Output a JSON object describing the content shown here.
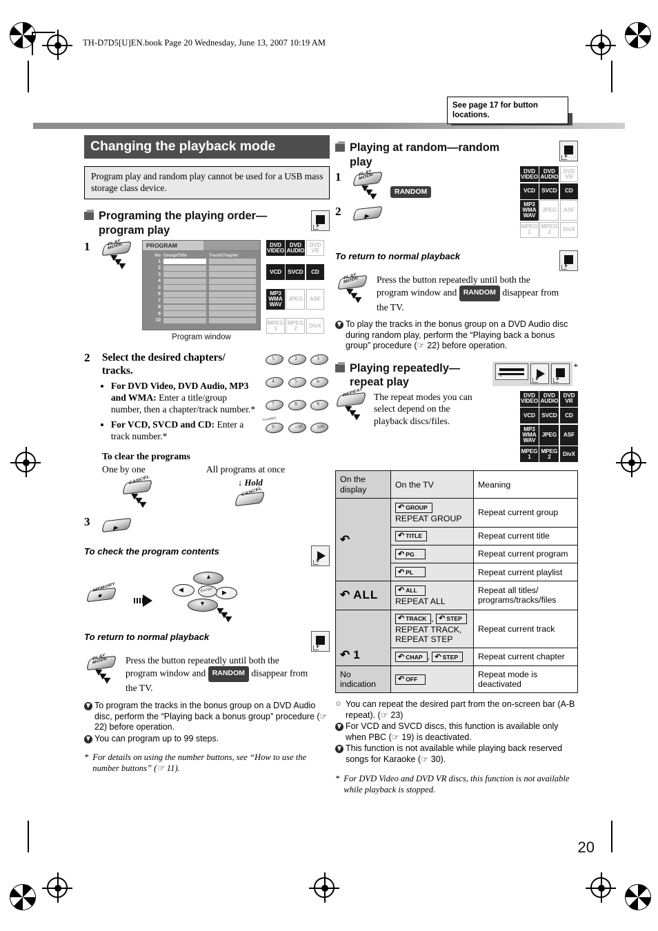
{
  "file_header": "TH-D7D5[U]EN.book  Page 20  Wednesday, June 13, 2007  10:19 AM",
  "page_number": "20",
  "callout": {
    "text": "See page 17 for button locations."
  },
  "left_column": {
    "section_title": "Changing the playback mode",
    "notice": "Program play and random play cannot be used for a USB mass storage class device.",
    "program": {
      "heading": "Programing the playing order—program play",
      "mode_icon": "stop-mode-icon",
      "discs": [
        {
          "label": "DVD VIDEO",
          "lines": [
            "DVD",
            "VIDEO"
          ],
          "active": true
        },
        {
          "label": "DVD AUDIO",
          "lines": [
            "DVD",
            "AUDIO"
          ],
          "active": true
        },
        {
          "label": "DVD VR",
          "lines": [
            "DVD",
            "VR"
          ],
          "active": false
        },
        {
          "label": "VCD",
          "lines": [
            "VCD"
          ],
          "active": true
        },
        {
          "label": "SVCD",
          "lines": [
            "SVCD"
          ],
          "active": true
        },
        {
          "label": "CD",
          "lines": [
            "CD"
          ],
          "active": true
        },
        {
          "label": "MP3 WMA WAV",
          "lines": [
            "MP3",
            "WMA",
            "WAV"
          ],
          "active": true
        },
        {
          "label": "JPEG",
          "lines": [
            "JPEG"
          ],
          "active": false
        },
        {
          "label": "ASF",
          "lines": [
            "ASF"
          ],
          "active": false
        },
        {
          "label": "MPEG 1",
          "lines": [
            "MPEG",
            "1"
          ],
          "active": false
        },
        {
          "label": "MPEG 2",
          "lines": [
            "MPEG",
            "2"
          ],
          "active": false
        },
        {
          "label": "DivX",
          "lines": [
            "DivX"
          ],
          "active": false
        }
      ],
      "step1": {
        "number": "1",
        "button_label": "PLAY\nMODE"
      },
      "program_window": {
        "tab": "PROGRAM",
        "columns": [
          "No",
          "Group/Title",
          "Track/Chapter"
        ],
        "rows": [
          "1",
          "2",
          "3",
          "4",
          "5",
          "6",
          "7",
          "8",
          "9",
          "10"
        ],
        "caption": "Program window"
      },
      "step2": {
        "number": "2",
        "title": "Select the desired chapters/ tracks.",
        "bullets": [
          {
            "bold": "For DVD Video, DVD Audio, MP3 and WMA:",
            "rest": " Enter a title/group number, then a chapter/track number.*"
          },
          {
            "bold": "For VCD, SVCD and CD:",
            "rest": " Enter a track number.*"
          }
        ],
        "keypad_keys": [
          "1",
          "2",
          "3",
          "4",
          "5",
          "6",
          "7",
          "8",
          "9",
          "0",
          "+10",
          "100"
        ],
        "keypad_sublabels": [
          "",
          "",
          "",
          "",
          "",
          "",
          "TV/VIDEO",
          "",
          "",
          "",
          "",
          "100"
        ]
      },
      "clear_programs": {
        "heading": "To clear the programs",
        "one_by_one_label": "One by one",
        "one_by_one_button": "CANCEL",
        "all_at_once_label": "All programs at once",
        "all_at_once_hold": "Hold",
        "all_at_once_button": "CANCEL"
      },
      "step3": {
        "number": "3",
        "button_label": "play"
      },
      "check_contents": {
        "heading": "To check the program contents",
        "mode_icon": "play-mode-icon",
        "memory_button": "MEMORY",
        "cursor_center": "ENTER"
      },
      "return_normal": {
        "heading": "To return to normal playback",
        "mode_icon": "stop-mode-icon",
        "button_label": "PLAY\nMODE",
        "text_before": "Press the button repeatedly until both the program window and ",
        "tag": "RANDOM",
        "text_after": " disappear from the TV."
      },
      "notes": [
        {
          "icon": "note",
          "text": "To program the tracks in the bonus group on a DVD Audio disc, perform the “Playing back a bonus group” procedure (☞ 22) before operation.",
          "page_ref": "22"
        },
        {
          "icon": "note",
          "text": "You can program up to 99 steps."
        }
      ],
      "footnote": "For details on using the number buttons, see “How to use the number buttons” (☞ 11)."
    }
  },
  "right_column": {
    "random": {
      "heading": "Playing at random—random play",
      "mode_icon": "stop-mode-icon",
      "discs": [
        {
          "label": "DVD VIDEO",
          "lines": [
            "DVD",
            "VIDEO"
          ],
          "active": true
        },
        {
          "label": "DVD AUDIO",
          "lines": [
            "DVD",
            "AUDIO"
          ],
          "active": true
        },
        {
          "label": "DVD VR",
          "lines": [
            "DVD",
            "VR"
          ],
          "active": false
        },
        {
          "label": "VCD",
          "lines": [
            "VCD"
          ],
          "active": true
        },
        {
          "label": "SVCD",
          "lines": [
            "SVCD"
          ],
          "active": true
        },
        {
          "label": "CD",
          "lines": [
            "CD"
          ],
          "active": true
        },
        {
          "label": "MP3 WMA WAV",
          "lines": [
            "MP3",
            "WMA",
            "WAV"
          ],
          "active": true
        },
        {
          "label": "JPEG",
          "lines": [
            "JPEG"
          ],
          "active": false
        },
        {
          "label": "ASF",
          "lines": [
            "ASF"
          ],
          "active": false
        },
        {
          "label": "MPEG 1",
          "lines": [
            "MPEG",
            "1"
          ],
          "active": false
        },
        {
          "label": "MPEG 2",
          "lines": [
            "MPEG",
            "2"
          ],
          "active": false
        },
        {
          "label": "DivX",
          "lines": [
            "DivX"
          ],
          "active": false
        }
      ],
      "step1": {
        "number": "1",
        "button_label": "PLAY\nMODE",
        "tag": "RANDOM"
      },
      "step2": {
        "number": "2",
        "button_label": "play"
      },
      "return_normal": {
        "heading": "To return to normal playback",
        "mode_icon": "stop-mode-icon",
        "button_label": "PLAY\nMODE",
        "text_before": "Press the button repeatedly until both the program window and ",
        "tag": "RANDOM",
        "text_after": " disappear from the TV."
      },
      "note": "To play the tracks in the bonus group on a DVD Audio disc during random play, perform the “Playing back a bonus group” procedure (☞ 22) before operation."
    },
    "repeat": {
      "heading": "Playing repeatedly— repeat play",
      "mode_icons": [
        "osd-bar-icon",
        "play-mode-icon",
        "stop-mode-icon"
      ],
      "mode_icon_asterisk": "*",
      "button_label": "REPEAT",
      "intro": "The repeat modes you can select depend on the playback discs/files.",
      "discs": [
        {
          "label": "DVD VIDEO",
          "lines": [
            "DVD",
            "VIDEO"
          ],
          "active": true
        },
        {
          "label": "DVD AUDIO",
          "lines": [
            "DVD",
            "AUDIO"
          ],
          "active": true
        },
        {
          "label": "DVD VR",
          "lines": [
            "DVD",
            "VR"
          ],
          "active": true
        },
        {
          "label": "VCD",
          "lines": [
            "VCD"
          ],
          "active": true
        },
        {
          "label": "SVCD",
          "lines": [
            "SVCD"
          ],
          "active": true
        },
        {
          "label": "CD",
          "lines": [
            "CD"
          ],
          "active": true
        },
        {
          "label": "MP3 WMA WAV",
          "lines": [
            "MP3",
            "WMA",
            "WAV"
          ],
          "active": true
        },
        {
          "label": "JPEG",
          "lines": [
            "JPEG"
          ],
          "active": true
        },
        {
          "label": "ASF",
          "lines": [
            "ASF"
          ],
          "active": true
        },
        {
          "label": "MPEG 1",
          "lines": [
            "MPEG",
            "1"
          ],
          "active": true
        },
        {
          "label": "MPEG 2",
          "lines": [
            "MPEG",
            "2"
          ],
          "active": true
        },
        {
          "label": "DivX",
          "lines": [
            "DivX"
          ],
          "active": true
        }
      ],
      "table": {
        "headers": [
          "On the display",
          "On the TV",
          "Meaning"
        ],
        "rows": [
          {
            "display": "↺",
            "display_span": 4,
            "tv_tags": [
              "GROUP"
            ],
            "tv_sub": "REPEAT GROUP",
            "meaning": "Repeat current group"
          },
          {
            "display": null,
            "tv_tags": [
              "TITLE"
            ],
            "tv_sub": "",
            "meaning": "Repeat current title"
          },
          {
            "display": null,
            "tv_tags": [
              "PG"
            ],
            "tv_sub": "",
            "meaning": "Repeat current program"
          },
          {
            "display": null,
            "tv_tags": [
              "PL"
            ],
            "tv_sub": "",
            "meaning": "Repeat current playlist"
          },
          {
            "display": "↺ ALL",
            "display_span": 1,
            "tv_tags": [
              "ALL"
            ],
            "tv_sub": "REPEAT ALL",
            "meaning": "Repeat all titles/ programs/tracks/files"
          },
          {
            "display": "↺ 1",
            "display_span": 2,
            "tv_tags": [
              "TRACK",
              "STEP"
            ],
            "tv_sub": "REPEAT TRACK, REPEAT STEP",
            "meaning": "Repeat current track"
          },
          {
            "display": null,
            "tv_tags": [
              "CHAP",
              "STEP"
            ],
            "tv_sub": "",
            "meaning": "Repeat current chapter"
          },
          {
            "display": "No indication",
            "display_span": 1,
            "tv_tags": [
              "OFF"
            ],
            "tv_sub": "",
            "meaning": "Repeat mode is deactivated"
          }
        ]
      },
      "notes": [
        {
          "icon": "tip",
          "text": "You can repeat the desired part from the on-screen bar (A-B repeat). (☞ 23)"
        },
        {
          "icon": "note",
          "text": "For VCD and SVCD discs, this function is available only when PBC (☞ 19) is deactivated."
        },
        {
          "icon": "note",
          "text": "This function is not available while playing back reserved songs for Karaoke (☞ 30)."
        }
      ],
      "footnote": "For DVD Video and DVD VR discs, this function is not available while playback is stopped."
    }
  }
}
